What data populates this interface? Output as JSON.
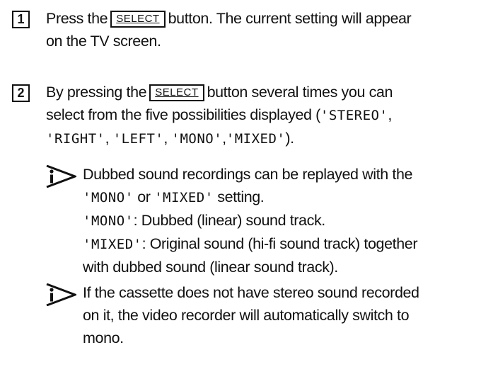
{
  "step1": {
    "number": "1",
    "pre": "Press the",
    "key": "SELECT",
    "post": "button. The current setting will appear",
    "line2": "on the TV screen."
  },
  "step2": {
    "number": "2",
    "pre": "By pressing the",
    "key": "SELECT",
    "post": "button several times you can",
    "line2_pre": "select from the five possibilities displayed (",
    "opt_stereo": "'STEREO'",
    "line2_post": ",",
    "opt_right": "'RIGHT'",
    "sep1": ", ",
    "opt_left": "'LEFT'",
    "sep2": ", ",
    "opt_mono": "'MONO'",
    "sep3": ",",
    "opt_mixed": "'MIXED'",
    "line3_post": ")."
  },
  "note1": {
    "icon": "info-arrow-icon",
    "l1": "Dubbed sound recordings can be replayed with the",
    "l2_mono": "'MONO'",
    "l2_mid": " or ",
    "l2_mixed": "'MIXED'",
    "l2_post": " setting.",
    "l3_mono": "'MONO'",
    "l3_post": ": Dubbed (linear) sound track.",
    "l4_mixed": "'MIXED'",
    "l4_post": ": Original sound (hi-fi sound track) together",
    "l5": "with dubbed sound (linear sound track)."
  },
  "note2": {
    "icon": "info-arrow-icon",
    "l1": "If the cassette does not have stereo sound recorded",
    "l2": "on it, the video recorder will automatically switch to",
    "l3": "mono."
  }
}
